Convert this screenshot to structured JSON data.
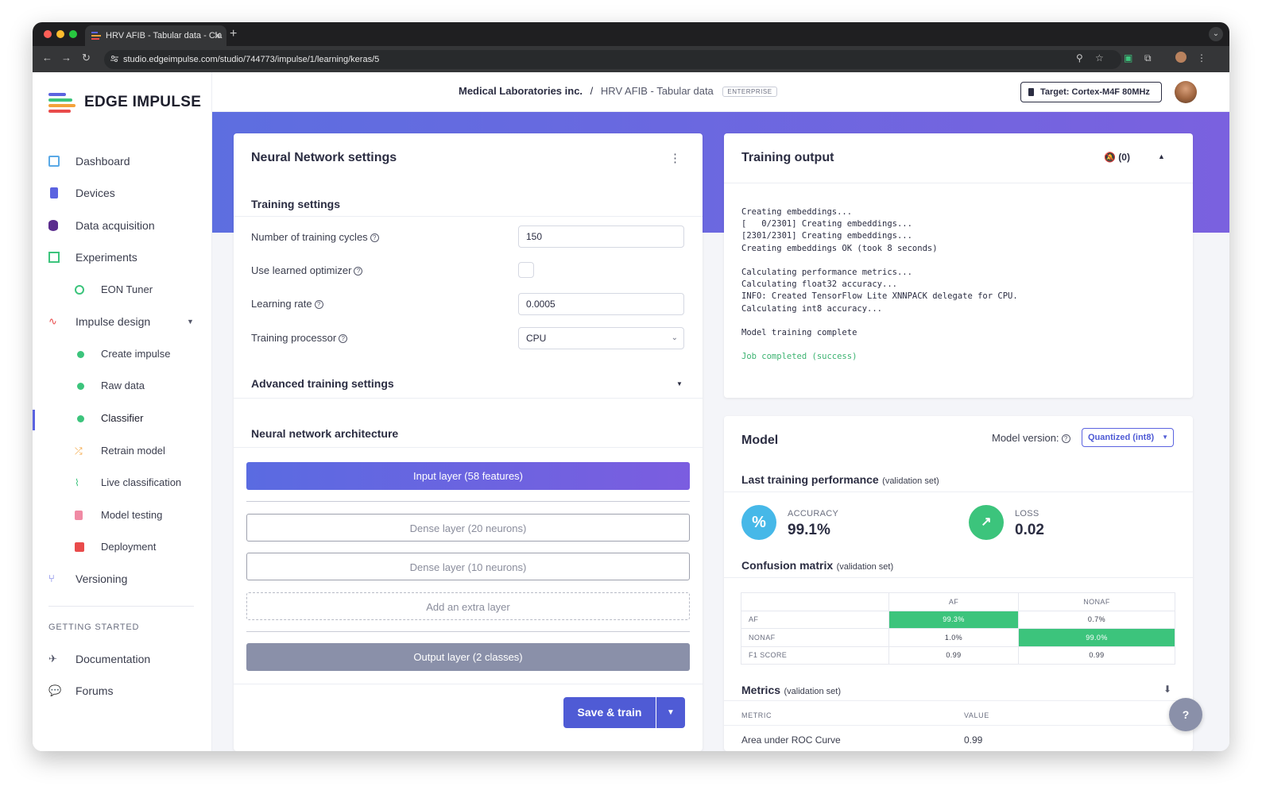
{
  "browser": {
    "tab_title": "HRV AFIB - Tabular data - Cla",
    "url": "studio.edgeimpulse.com/studio/744773/impulse/1/learning/keras/5"
  },
  "brand": {
    "name": "EDGE IMPULSE"
  },
  "sidebar": {
    "items": [
      {
        "label": "Dashboard"
      },
      {
        "label": "Devices"
      },
      {
        "label": "Data acquisition"
      },
      {
        "label": "Experiments"
      },
      {
        "label": "EON Tuner"
      },
      {
        "label": "Impulse design"
      },
      {
        "label": "Create impulse"
      },
      {
        "label": "Raw data"
      },
      {
        "label": "Classifier"
      },
      {
        "label": "Retrain model"
      },
      {
        "label": "Live classification"
      },
      {
        "label": "Model testing"
      },
      {
        "label": "Deployment"
      },
      {
        "label": "Versioning"
      }
    ],
    "section_header": "GETTING STARTED",
    "footer_items": [
      {
        "label": "Documentation"
      },
      {
        "label": "Forums"
      }
    ]
  },
  "header": {
    "org": "Medical Laboratories inc.",
    "separator": "/",
    "project": "HRV AFIB - Tabular data",
    "badge": "ENTERPRISE",
    "target": "Target: Cortex-M4F 80MHz"
  },
  "nn_settings": {
    "title": "Neural Network settings",
    "training_settings_title": "Training settings",
    "fields": {
      "cycles_label": "Number of training cycles",
      "cycles_value": "150",
      "optimizer_label": "Use learned optimizer",
      "lr_label": "Learning rate",
      "lr_value": "0.0005",
      "processor_label": "Training processor",
      "processor_value": "CPU"
    },
    "advanced_title": "Advanced training settings",
    "architecture_title": "Neural network architecture",
    "layers": {
      "input": "Input layer (58 features)",
      "dense1": "Dense layer (20 neurons)",
      "dense2": "Dense layer (10 neurons)",
      "add": "Add an extra layer",
      "output": "Output layer (2 classes)"
    },
    "save_label": "Save & train"
  },
  "training_output": {
    "title": "Training output",
    "notifications": "(0)",
    "log_lines": [
      "Creating embeddings...",
      "[   0/2301] Creating embeddings...",
      "[2301/2301] Creating embeddings...",
      "Creating embeddings OK (took 8 seconds)",
      "",
      "Calculating performance metrics...",
      "Calculating float32 accuracy...",
      "INFO: Created TensorFlow Lite XNNPACK delegate for CPU.",
      "Calculating int8 accuracy...",
      "",
      "Model training complete",
      ""
    ],
    "success_line": "Job completed (success)"
  },
  "model": {
    "title": "Model",
    "version_label": "Model version:",
    "version_value": "Quantized (int8)",
    "last_perf_title": "Last training performance",
    "validation_note": "(validation set)",
    "accuracy_label": "ACCURACY",
    "accuracy_value": "99.1%",
    "loss_label": "LOSS",
    "loss_value": "0.02",
    "confusion_title": "Confusion matrix",
    "confusion": {
      "columns": [
        "AF",
        "NONAF"
      ],
      "rows": [
        {
          "label": "AF",
          "values": [
            "99.3%",
            "0.7%"
          ]
        },
        {
          "label": "NONAF",
          "values": [
            "1.0%",
            "99.0%"
          ]
        },
        {
          "label": "F1 SCORE",
          "values": [
            "0.99",
            "0.99"
          ]
        }
      ]
    },
    "metrics_title": "Metrics",
    "metrics_header_metric": "METRIC",
    "metrics_header_value": "VALUE",
    "metrics_first_row_label": "Area under ROC Curve",
    "metrics_first_row_value": "0.99"
  },
  "help_button": "?"
}
